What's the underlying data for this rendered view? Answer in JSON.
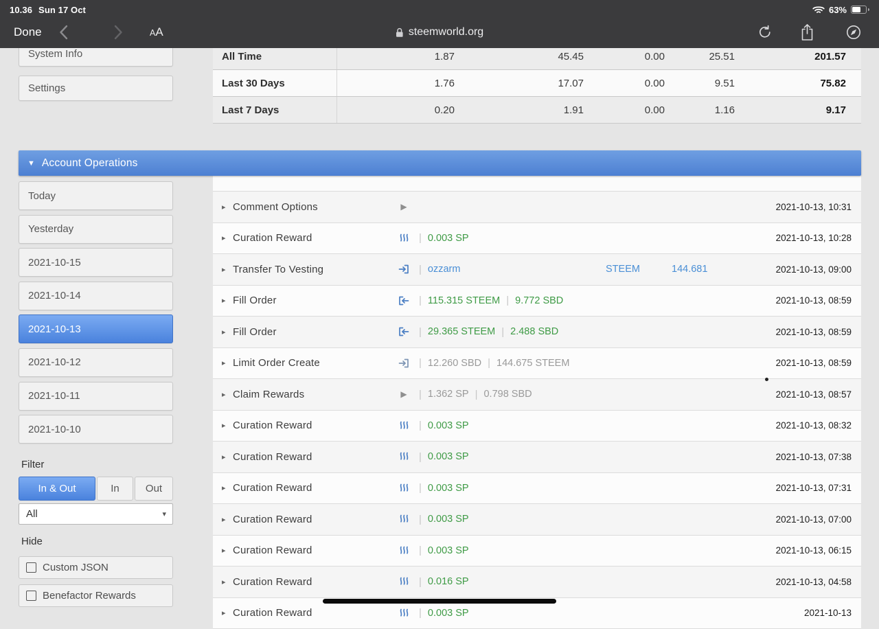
{
  "colors": {
    "green": "#3f9b46",
    "blue": "#4a8fd6",
    "gray": "#9a9a9a",
    "accent_blue": "#4c7fd2"
  },
  "status_bar": {
    "time": "10.36",
    "date": "Sun 17 Oct",
    "battery": "63%"
  },
  "browser_bar": {
    "done": "Done",
    "font": "AA",
    "url": "steemworld.org"
  },
  "summary_table": {
    "rows": [
      {
        "label": "All Time",
        "values": [
          "1.87",
          "45.45",
          "0.00",
          "25.51",
          "201.57"
        ]
      },
      {
        "label": "Last 30 Days",
        "values": [
          "1.76",
          "17.07",
          "0.00",
          "9.51",
          "75.82"
        ]
      },
      {
        "label": "Last 7 Days",
        "values": [
          "0.20",
          "1.91",
          "0.00",
          "1.16",
          "9.17"
        ]
      }
    ]
  },
  "sidebar": {
    "top_items": [
      "System Info",
      "Settings"
    ],
    "section_title": "Account Operations",
    "dates": [
      {
        "label": "Today"
      },
      {
        "label": "Yesterday"
      },
      {
        "label": "2021-10-15"
      },
      {
        "label": "2021-10-14"
      },
      {
        "label": "2021-10-13",
        "selected": true
      },
      {
        "label": "2021-10-12"
      },
      {
        "label": "2021-10-11"
      },
      {
        "label": "2021-10-10"
      }
    ],
    "filter": {
      "label": "Filter",
      "options": [
        "In & Out",
        "In",
        "Out"
      ],
      "selected": "In & Out",
      "dropdown_value": "All"
    },
    "hide": {
      "label": "Hide",
      "checkboxes": [
        {
          "label": "Custom JSON",
          "checked": false
        },
        {
          "label": "Benefactor Rewards",
          "checked": false
        }
      ]
    }
  },
  "operations": [
    {
      "name": "Comment Options",
      "icon": "play-icon",
      "values": [],
      "date": "2021-10-13, 10:31"
    },
    {
      "name": "Curation Reward",
      "icon": "curation-icon",
      "values": [
        {
          "text": "0.003 SP",
          "c": "green"
        }
      ],
      "date": "2021-10-13, 10:28"
    },
    {
      "name": "Transfer To Vesting",
      "icon": "transfer-icon",
      "values": [
        {
          "text": "ozzarm",
          "c": "blue"
        }
      ],
      "extras": [
        {
          "text": "STEEM"
        },
        {
          "text": "144.681"
        }
      ],
      "date": "2021-10-13, 09:00"
    },
    {
      "name": "Fill Order",
      "icon": "fill-order-icon",
      "values": [
        {
          "text": "115.315 STEEM",
          "c": "green"
        },
        {
          "text": "9.772 SBD",
          "c": "green"
        }
      ],
      "date": "2021-10-13, 08:59"
    },
    {
      "name": "Fill Order",
      "icon": "fill-order-icon",
      "values": [
        {
          "text": "29.365 STEEM",
          "c": "green"
        },
        {
          "text": "2.488 SBD",
          "c": "green"
        }
      ],
      "date": "2021-10-13, 08:59"
    },
    {
      "name": "Limit Order Create",
      "icon": "limit-order-icon",
      "values": [
        {
          "text": "12.260 SBD",
          "c": "gray"
        },
        {
          "text": "144.675 STEEM",
          "c": "gray"
        }
      ],
      "date": "2021-10-13, 08:59"
    },
    {
      "name": "Claim Rewards",
      "icon": "play-icon",
      "values": [
        {
          "text": "1.362 SP",
          "c": "gray"
        },
        {
          "text": "0.798 SBD",
          "c": "gray"
        }
      ],
      "date": "2021-10-13, 08:57"
    },
    {
      "name": "Curation Reward",
      "icon": "curation-icon",
      "values": [
        {
          "text": "0.003 SP",
          "c": "green"
        }
      ],
      "date": "2021-10-13, 08:32"
    },
    {
      "name": "Curation Reward",
      "icon": "curation-icon",
      "values": [
        {
          "text": "0.003 SP",
          "c": "green"
        }
      ],
      "date": "2021-10-13, 07:38"
    },
    {
      "name": "Curation Reward",
      "icon": "curation-icon",
      "values": [
        {
          "text": "0.003 SP",
          "c": "green"
        }
      ],
      "date": "2021-10-13, 07:31"
    },
    {
      "name": "Curation Reward",
      "icon": "curation-icon",
      "values": [
        {
          "text": "0.003 SP",
          "c": "green"
        }
      ],
      "date": "2021-10-13, 07:00"
    },
    {
      "name": "Curation Reward",
      "icon": "curation-icon",
      "values": [
        {
          "text": "0.003 SP",
          "c": "green"
        }
      ],
      "date": "2021-10-13, 06:15"
    },
    {
      "name": "Curation Reward",
      "icon": "curation-icon",
      "values": [
        {
          "text": "0.016 SP",
          "c": "green"
        }
      ],
      "date": "2021-10-13, 04:58"
    },
    {
      "name": "Curation Reward",
      "icon": "curation-icon",
      "values": [
        {
          "text": "0.003 SP",
          "c": "green"
        }
      ],
      "date": "2021-10-13",
      "partial": true
    }
  ]
}
